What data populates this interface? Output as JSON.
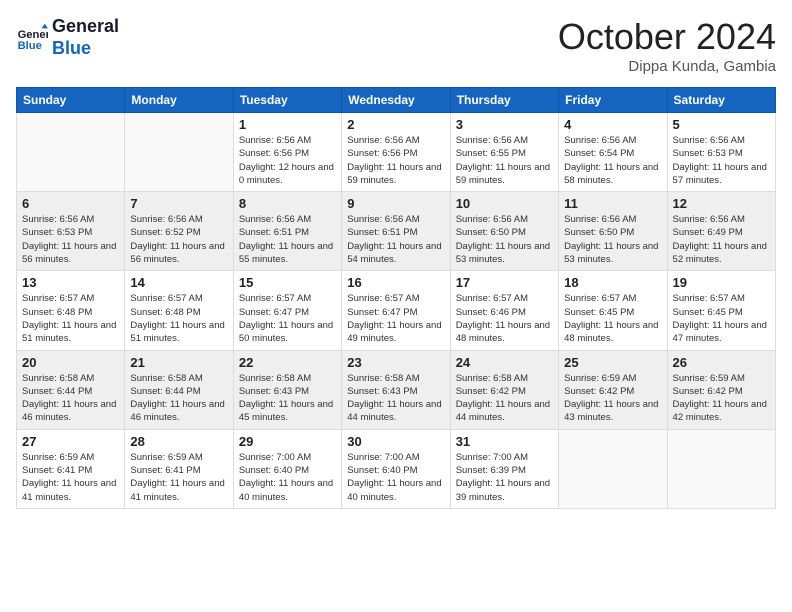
{
  "header": {
    "logo_line1": "General",
    "logo_line2": "Blue",
    "month": "October 2024",
    "location": "Dippa Kunda, Gambia"
  },
  "weekdays": [
    "Sunday",
    "Monday",
    "Tuesday",
    "Wednesday",
    "Thursday",
    "Friday",
    "Saturday"
  ],
  "weeks": [
    [
      {
        "day": "",
        "empty": true
      },
      {
        "day": "",
        "empty": true
      },
      {
        "day": "1",
        "sunrise": "6:56 AM",
        "sunset": "6:56 PM",
        "daylight": "12 hours and 0 minutes."
      },
      {
        "day": "2",
        "sunrise": "6:56 AM",
        "sunset": "6:56 PM",
        "daylight": "11 hours and 59 minutes."
      },
      {
        "day": "3",
        "sunrise": "6:56 AM",
        "sunset": "6:55 PM",
        "daylight": "11 hours and 59 minutes."
      },
      {
        "day": "4",
        "sunrise": "6:56 AM",
        "sunset": "6:54 PM",
        "daylight": "11 hours and 58 minutes."
      },
      {
        "day": "5",
        "sunrise": "6:56 AM",
        "sunset": "6:53 PM",
        "daylight": "11 hours and 57 minutes."
      }
    ],
    [
      {
        "day": "6",
        "sunrise": "6:56 AM",
        "sunset": "6:53 PM",
        "daylight": "11 hours and 56 minutes."
      },
      {
        "day": "7",
        "sunrise": "6:56 AM",
        "sunset": "6:52 PM",
        "daylight": "11 hours and 56 minutes."
      },
      {
        "day": "8",
        "sunrise": "6:56 AM",
        "sunset": "6:51 PM",
        "daylight": "11 hours and 55 minutes."
      },
      {
        "day": "9",
        "sunrise": "6:56 AM",
        "sunset": "6:51 PM",
        "daylight": "11 hours and 54 minutes."
      },
      {
        "day": "10",
        "sunrise": "6:56 AM",
        "sunset": "6:50 PM",
        "daylight": "11 hours and 53 minutes."
      },
      {
        "day": "11",
        "sunrise": "6:56 AM",
        "sunset": "6:50 PM",
        "daylight": "11 hours and 53 minutes."
      },
      {
        "day": "12",
        "sunrise": "6:56 AM",
        "sunset": "6:49 PM",
        "daylight": "11 hours and 52 minutes."
      }
    ],
    [
      {
        "day": "13",
        "sunrise": "6:57 AM",
        "sunset": "6:48 PM",
        "daylight": "11 hours and 51 minutes."
      },
      {
        "day": "14",
        "sunrise": "6:57 AM",
        "sunset": "6:48 PM",
        "daylight": "11 hours and 51 minutes."
      },
      {
        "day": "15",
        "sunrise": "6:57 AM",
        "sunset": "6:47 PM",
        "daylight": "11 hours and 50 minutes."
      },
      {
        "day": "16",
        "sunrise": "6:57 AM",
        "sunset": "6:47 PM",
        "daylight": "11 hours and 49 minutes."
      },
      {
        "day": "17",
        "sunrise": "6:57 AM",
        "sunset": "6:46 PM",
        "daylight": "11 hours and 48 minutes."
      },
      {
        "day": "18",
        "sunrise": "6:57 AM",
        "sunset": "6:45 PM",
        "daylight": "11 hours and 48 minutes."
      },
      {
        "day": "19",
        "sunrise": "6:57 AM",
        "sunset": "6:45 PM",
        "daylight": "11 hours and 47 minutes."
      }
    ],
    [
      {
        "day": "20",
        "sunrise": "6:58 AM",
        "sunset": "6:44 PM",
        "daylight": "11 hours and 46 minutes."
      },
      {
        "day": "21",
        "sunrise": "6:58 AM",
        "sunset": "6:44 PM",
        "daylight": "11 hours and 46 minutes."
      },
      {
        "day": "22",
        "sunrise": "6:58 AM",
        "sunset": "6:43 PM",
        "daylight": "11 hours and 45 minutes."
      },
      {
        "day": "23",
        "sunrise": "6:58 AM",
        "sunset": "6:43 PM",
        "daylight": "11 hours and 44 minutes."
      },
      {
        "day": "24",
        "sunrise": "6:58 AM",
        "sunset": "6:42 PM",
        "daylight": "11 hours and 44 minutes."
      },
      {
        "day": "25",
        "sunrise": "6:59 AM",
        "sunset": "6:42 PM",
        "daylight": "11 hours and 43 minutes."
      },
      {
        "day": "26",
        "sunrise": "6:59 AM",
        "sunset": "6:42 PM",
        "daylight": "11 hours and 42 minutes."
      }
    ],
    [
      {
        "day": "27",
        "sunrise": "6:59 AM",
        "sunset": "6:41 PM",
        "daylight": "11 hours and 41 minutes."
      },
      {
        "day": "28",
        "sunrise": "6:59 AM",
        "sunset": "6:41 PM",
        "daylight": "11 hours and 41 minutes."
      },
      {
        "day": "29",
        "sunrise": "7:00 AM",
        "sunset": "6:40 PM",
        "daylight": "11 hours and 40 minutes."
      },
      {
        "day": "30",
        "sunrise": "7:00 AM",
        "sunset": "6:40 PM",
        "daylight": "11 hours and 40 minutes."
      },
      {
        "day": "31",
        "sunrise": "7:00 AM",
        "sunset": "6:39 PM",
        "daylight": "11 hours and 39 minutes."
      },
      {
        "day": "",
        "empty": true
      },
      {
        "day": "",
        "empty": true
      }
    ]
  ]
}
